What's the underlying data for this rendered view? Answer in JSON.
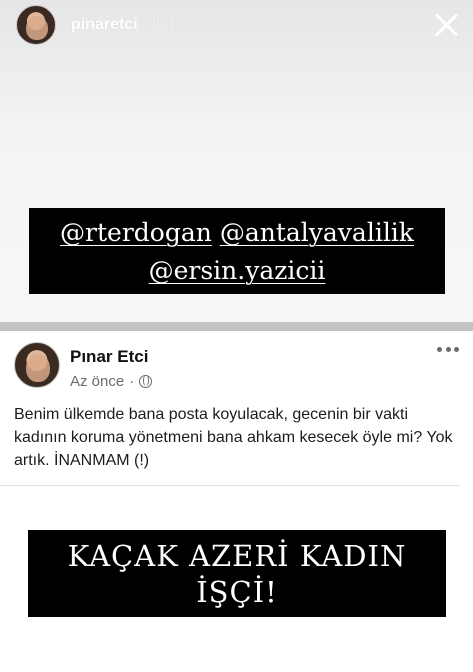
{
  "story": {
    "username": "pinaretci",
    "age": "40d",
    "mentions": [
      "@rterdogan",
      "@antalyavalilik",
      "@ersin.yazicii"
    ]
  },
  "post": {
    "author": "Pınar Etci",
    "time": "Az önce",
    "separator": "·",
    "privacy_icon": "globe-icon",
    "text": "Benim ülkemde bana posta koyulacak, gecenin bir vakti kadının koruma yönetmeni bana ahkam kesecek öyle mi? Yok artık. İNANMAM (!)",
    "banner_lines": [
      "KAÇAK AZERİ KADIN",
      "İŞÇİ!"
    ]
  },
  "colors": {
    "banner_bg": "#000000",
    "banner_text": "#ffffff",
    "divider": "#c3c3c3"
  }
}
